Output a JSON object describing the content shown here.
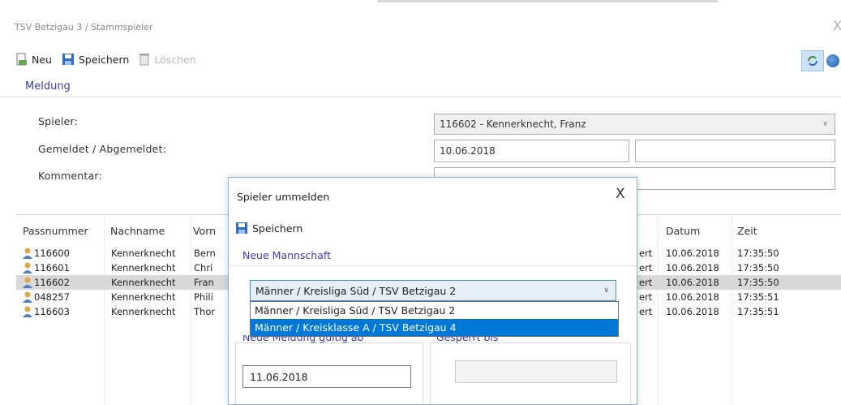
{
  "window": {
    "title": "TSV Betzigau 3 / Stammspieler",
    "close_glyph": "X"
  },
  "toolbar": {
    "new_label": "Neu",
    "save_label": "Speichern",
    "delete_label": "Löschen"
  },
  "form": {
    "section_title": "Meldung",
    "spieler_label": "Spieler:",
    "spieler_value": "116602 - Kennerknecht, Franz",
    "gemeldet_label": "Gemeldet / Abgemeldet:",
    "gemeldet_value": "10.06.2018",
    "abgemeldet_value": "",
    "kommentar_label": "Kommentar:",
    "kommentar_value": ""
  },
  "table": {
    "headers": [
      "Passnummer",
      "Nachname",
      "Vorn",
      "Datum",
      "Zeit"
    ],
    "rows": [
      {
        "pass": "116600",
        "nachname": "Kennerknecht",
        "vorname": "Bern",
        "status": "ert",
        "datum": "10.06.2018",
        "zeit": "17:35:50"
      },
      {
        "pass": "116601",
        "nachname": "Kennerknecht",
        "vorname": "Chri",
        "status": "ert",
        "datum": "10.06.2018",
        "zeit": "17:35:50"
      },
      {
        "pass": "116602",
        "nachname": "Kennerknecht",
        "vorname": "Fran",
        "status": "ert",
        "datum": "10.06.2018",
        "zeit": "17:35:50"
      },
      {
        "pass": "048257",
        "nachname": "Kennerknecht",
        "vorname": "Phili",
        "status": "ert",
        "datum": "10.06.2018",
        "zeit": "17:35:51"
      },
      {
        "pass": "116603",
        "nachname": "Kennerknecht",
        "vorname": "Thor",
        "status": "ert",
        "datum": "10.06.2018",
        "zeit": "17:35:51"
      }
    ]
  },
  "dialog": {
    "title": "Spieler ummelden",
    "close_glyph": "X",
    "save_label": "Speichern",
    "section_title": "Neue Mannschaft",
    "selected_team": "Männer / Kreisliga Süd / TSV Betzigau 2",
    "options": [
      "Männer / Kreisliga Süd / TSV Betzigau 2",
      "Männer / Kreisklasse A / TSV Betzigau 4"
    ],
    "date_label": "Neue Meldung gültig ab",
    "date_value": "11.06.2018",
    "blocked_label": "Gesperrt bis"
  },
  "colors": {
    "accent": "#3c3cb8",
    "selection": "#0078d7",
    "row_selected": "#d9d9d9"
  }
}
